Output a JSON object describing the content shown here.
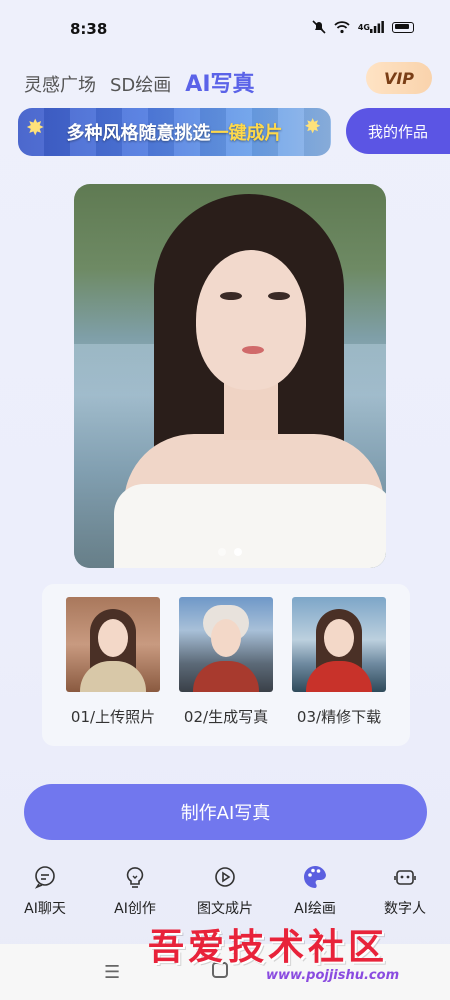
{
  "status": {
    "time": "8:38",
    "network": "4G"
  },
  "tabs": [
    {
      "label": "灵感广场",
      "active": false
    },
    {
      "label": "SD绘画",
      "active": false
    },
    {
      "label": "AI写真",
      "active": true
    }
  ],
  "vip_label": "VIP",
  "banner": {
    "text_prefix": "多种风格随意挑选",
    "text_highlight": "一键成片"
  },
  "my_works_label": "我的作品",
  "hero": {
    "slide_count": 2,
    "active_slide": 2
  },
  "steps": [
    {
      "label": "01/上传照片"
    },
    {
      "label": "02/生成写真"
    },
    {
      "label": "03/精修下载"
    }
  ],
  "make_button_label": "制作AI写真",
  "bottom_nav": [
    {
      "label": "AI聊天",
      "icon": "chat-bubble-icon",
      "active": false
    },
    {
      "label": "AI创作",
      "icon": "lightbulb-icon",
      "active": false
    },
    {
      "label": "图文成片",
      "icon": "play-video-icon",
      "active": false
    },
    {
      "label": "AI绘画",
      "icon": "palette-icon",
      "active": true
    },
    {
      "label": "数字人",
      "icon": "robot-icon",
      "active": false
    }
  ],
  "watermark": {
    "title": "吾爱技术社区",
    "url": "www.pojjishu.com"
  },
  "colors": {
    "accent": "#5b63e8",
    "button": "#7177ee",
    "my_works": "#5b55e4",
    "active_nav": "#5b5fe0"
  }
}
